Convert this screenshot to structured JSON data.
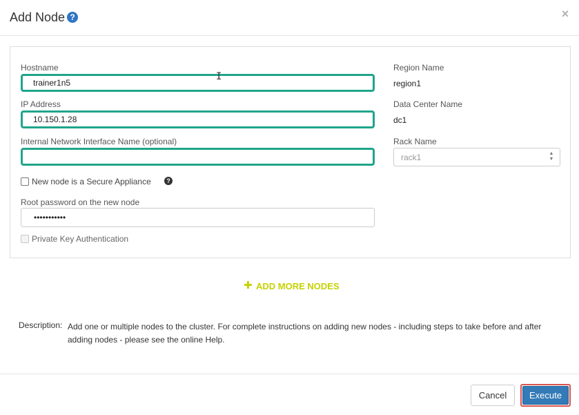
{
  "dialog": {
    "title": "Add Node",
    "help_icon": "question-circle-icon",
    "close_icon": "close-icon",
    "close_glyph": "×"
  },
  "form": {
    "hostname": {
      "label": "Hostname",
      "value": "trainer1n5"
    },
    "ip_address": {
      "label": "IP Address",
      "value": "10.150.1.28"
    },
    "interface_name": {
      "label": "Internal Network Interface Name (optional)",
      "value": ""
    },
    "secure_appliance": {
      "label": "New node is a Secure Appliance",
      "checked": false
    },
    "root_password": {
      "label": "Root password on the new node",
      "value": "•••••••••••"
    },
    "private_key": {
      "label": "Private Key Authentication",
      "checked": false,
      "disabled": true
    },
    "region": {
      "label": "Region Name",
      "value": "region1"
    },
    "data_center": {
      "label": "Data Center Name",
      "value": "dc1"
    },
    "rack": {
      "label": "Rack Name",
      "value": "rack1"
    }
  },
  "add_more": {
    "label": "ADD MORE NODES",
    "icon": "plus-icon",
    "color": "#c5d200"
  },
  "description": {
    "label": "Description:",
    "text": "Add one or multiple nodes to the cluster. For complete instructions on adding new nodes - including steps to take before and after adding nodes - please see the online Help."
  },
  "footer": {
    "cancel_label": "Cancel",
    "execute_label": "Execute"
  },
  "colors": {
    "highlight_border": "#1fa58a",
    "primary_button": "#337ab7",
    "execute_outline": "#d9534f",
    "help_icon": "#2f76c4"
  }
}
